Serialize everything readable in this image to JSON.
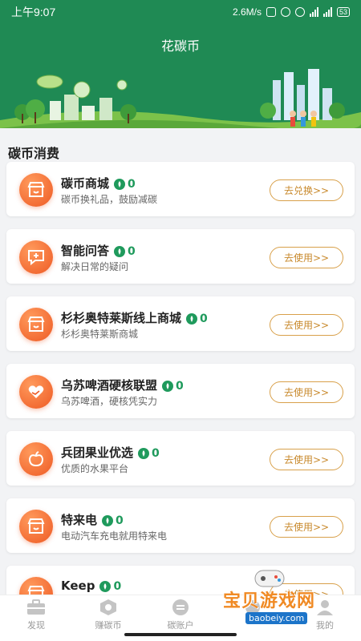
{
  "status_bar": {
    "time": "上午9:07",
    "speed": "2.6M/s",
    "battery": "53"
  },
  "header": {
    "title": "花碳币"
  },
  "section": {
    "title": "碳币消费"
  },
  "colors": {
    "brand_green": "#1f8a54",
    "accent_orange": "#ee5a24",
    "button_gold": "#d8a04a",
    "coin_green": "#1f9a5c"
  },
  "items": [
    {
      "title": "碳币商城",
      "coins": "0",
      "desc": "碳币换礼品，鼓励减碳",
      "button": "去兑换>>",
      "icon": "shop-icon"
    },
    {
      "title": "智能问答",
      "coins": "0",
      "desc": "解决日常的疑问",
      "button": "去使用>>",
      "icon": "chat-icon"
    },
    {
      "title": "杉杉奥特莱斯线上商城",
      "coins": "0",
      "desc": "杉杉奥特莱斯商城",
      "button": "去使用>>",
      "icon": "shop-icon"
    },
    {
      "title": "乌苏啤酒硬核联盟",
      "coins": "0",
      "desc": "乌苏啤酒，硬核凭实力",
      "button": "去使用>>",
      "icon": "heart-hand-icon"
    },
    {
      "title": "兵团果业优选",
      "coins": "0",
      "desc": "优质的水果平台",
      "button": "去使用>>",
      "icon": "fruit-icon"
    },
    {
      "title": "特来电",
      "coins": "0",
      "desc": "电动汽车充电就用特来电",
      "button": "去使用>>",
      "icon": "shop-icon"
    },
    {
      "title": "Keep",
      "coins": "0",
      "desc": "",
      "button": "去使用>>",
      "icon": "shop-icon"
    }
  ],
  "tabs": [
    {
      "label": "发现",
      "icon": "briefcase-icon"
    },
    {
      "label": "赚碳币",
      "icon": "hexagon-icon"
    },
    {
      "label": "碳账户",
      "icon": "chat-bubble-icon"
    },
    {
      "label": "",
      "icon": "tab-icon"
    },
    {
      "label": "我的",
      "icon": "profile-icon"
    }
  ],
  "watermark": {
    "text": "宝贝游戏网",
    "url": "baobeiy.com"
  }
}
